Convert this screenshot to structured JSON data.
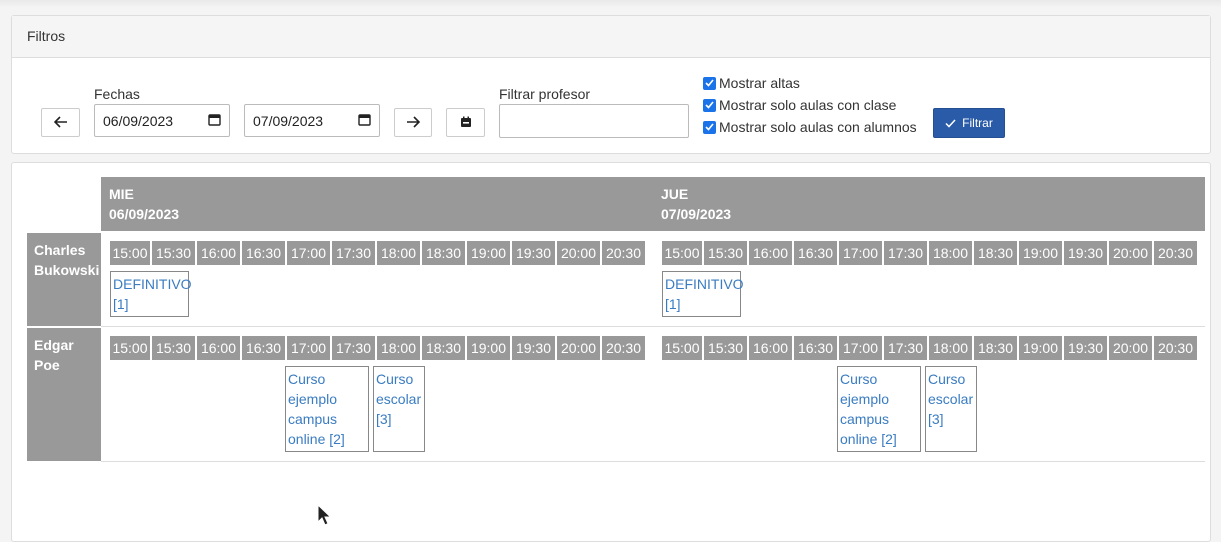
{
  "filters": {
    "title": "Filtros",
    "prev_label": "←",
    "next_label": "→",
    "fechas_label": "Fechas",
    "date_from": "06/09/2023",
    "date_to": "07/09/2023",
    "profesor_label": "Filtrar profesor",
    "profesor_value": "",
    "checkboxes": [
      "Mostrar altas",
      "Mostrar solo aulas con clase",
      "Mostrar solo aulas con alumnos"
    ],
    "submit_label": "Filtrar",
    "accent_color": "#2a5ba8"
  },
  "schedule": {
    "days": [
      {
        "name": "MIE",
        "date": "06/09/2023"
      },
      {
        "name": "JUE",
        "date": "07/09/2023"
      }
    ],
    "times": [
      "15:00",
      "15:30",
      "16:00",
      "16:30",
      "17:00",
      "17:30",
      "18:00",
      "18:30",
      "19:00",
      "19:30",
      "20:00",
      "20:30"
    ],
    "teachers": [
      {
        "name_line1": "Charles",
        "name_line2": "Bukowski",
        "day1_events": [
          {
            "text": "DEFINITIVO\n[1]"
          }
        ],
        "day2_events": [
          {
            "text": "DEFINITIVO\n[1]"
          }
        ]
      },
      {
        "name_line1": "Edgar",
        "name_line2": "Poe",
        "day1_events": [
          {
            "text": "Curso\nejemplo\ncampus\nonline [2]"
          },
          {
            "text": "Curso\nescolar\n[3]"
          }
        ],
        "day2_events": [
          {
            "text": "Curso\nejemplo\ncampus\nonline [2]"
          },
          {
            "text": "Curso\nescolar\n[3]"
          }
        ]
      }
    ]
  }
}
